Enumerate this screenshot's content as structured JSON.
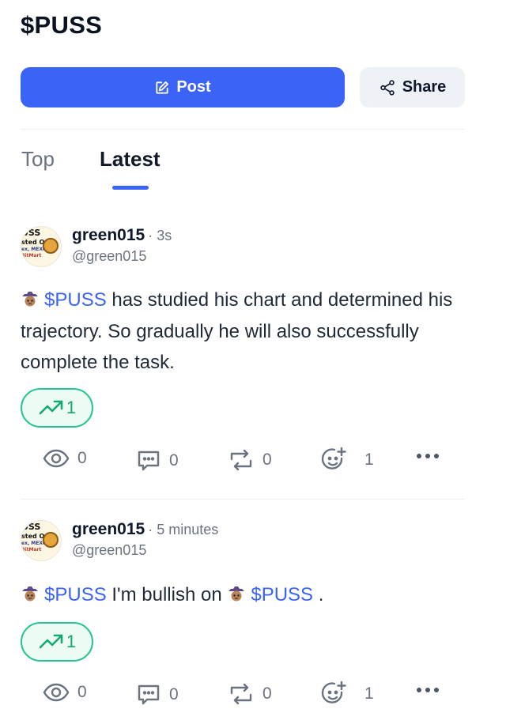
{
  "page": {
    "title": "$PUSS"
  },
  "toolbar": {
    "post_label": "Post",
    "share_label": "Share"
  },
  "tabs": [
    {
      "label": "Top",
      "active": false
    },
    {
      "label": "Latest",
      "active": true
    }
  ],
  "colors": {
    "accent": "#3b63f6",
    "trend_green": "#22c58b",
    "muted": "#6b7280"
  },
  "avatar_text": {
    "line1": "USS",
    "line2": "sted On",
    "line3": "ex, MEXC,",
    "line4": "BitMart"
  },
  "posts": [
    {
      "username": "green015",
      "time": "· 3s",
      "handle": "@green015",
      "ticker": "$PUSS",
      "text_after": " has studied his chart and determined his trajectory. So gradually he will also successfully complete the task.",
      "trend_count": "1",
      "stats": {
        "views": "0",
        "comments": "0",
        "reposts": "0",
        "reactions": "1"
      }
    },
    {
      "username": "green015",
      "time": "· 5 minutes",
      "handle": "@green015",
      "ticker": "$PUSS",
      "text_mid": " I'm bullish on ",
      "ticker2": "$PUSS",
      "text_end": " .",
      "trend_count": "1",
      "stats": {
        "views": "0",
        "comments": "0",
        "reposts": "0",
        "reactions": "1"
      }
    }
  ]
}
